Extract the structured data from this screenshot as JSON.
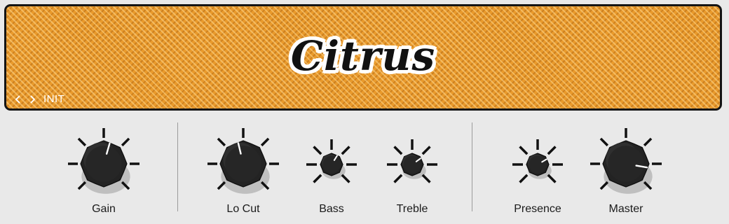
{
  "header": {
    "logo_text": "Citrus",
    "preset": {
      "prev_icon": "chevron-left-icon",
      "next_icon": "chevron-right-icon",
      "name": "INIT"
    }
  },
  "knobs": [
    {
      "id": "gain",
      "label": "Gain",
      "value": 0.56
    },
    {
      "id": "lo-cut",
      "label": "Lo Cut",
      "value": 0.45
    },
    {
      "id": "bass",
      "label": "Bass",
      "value": 0.62
    },
    {
      "id": "treble",
      "label": "Treble",
      "value": 0.7
    },
    {
      "id": "presence",
      "label": "Presence",
      "value": 0.72
    },
    {
      "id": "master",
      "label": "Master",
      "value": 0.87
    }
  ],
  "colors": {
    "grille": "#e99a2c",
    "panel": "#e9e9e9",
    "knob": "#2a2a2a",
    "indicator": "#ffffff"
  }
}
